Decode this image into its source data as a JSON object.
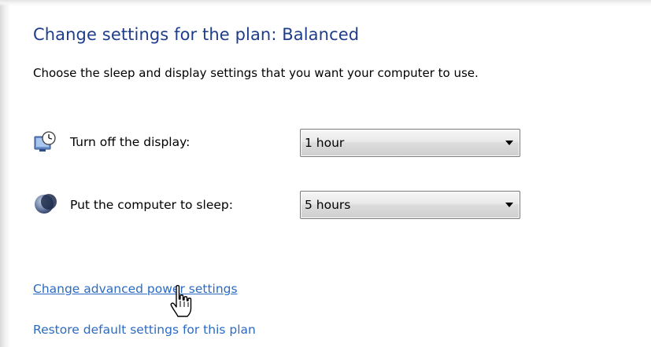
{
  "header": {
    "title": "Change settings for the plan: Balanced",
    "subtitle": "Choose the sleep and display settings that you want your computer to use."
  },
  "settings": {
    "display": {
      "icon": "display-clock-icon",
      "label": "Turn off the display:",
      "value": "1 hour"
    },
    "sleep": {
      "icon": "sleep-moon-icon",
      "label": "Put the computer to sleep:",
      "value": "5 hours"
    }
  },
  "links": {
    "advanced": "Change advanced power settings",
    "restore": "Restore default settings for this plan"
  },
  "pointer": {
    "icon": "hand-pointer-icon"
  },
  "colors": {
    "title": "#1e3d8a",
    "link": "#2a6bc4"
  }
}
